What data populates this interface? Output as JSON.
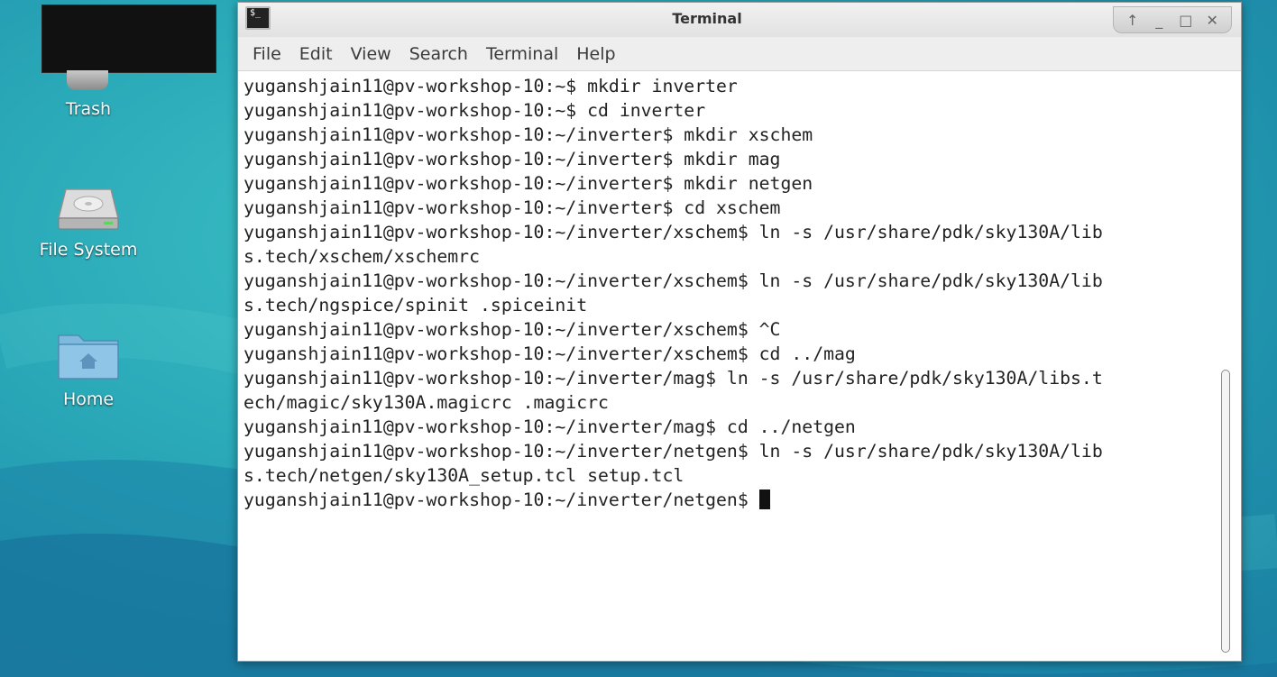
{
  "desktop": {
    "icons": [
      {
        "label": "Trash",
        "icon": "trash-icon"
      },
      {
        "label": "File System",
        "icon": "drive-icon"
      },
      {
        "label": "Home",
        "icon": "home-folder-icon"
      }
    ]
  },
  "window": {
    "title": "Terminal",
    "title_icon_glyph": "$_",
    "controls": {
      "shade": "↑",
      "minimize": "_",
      "maximize": "□",
      "close": "✕"
    },
    "menu": [
      "File",
      "Edit",
      "View",
      "Search",
      "Terminal",
      "Help"
    ]
  },
  "terminal": {
    "lines": [
      "yuganshjain11@pv-workshop-10:~$ mkdir inverter",
      "yuganshjain11@pv-workshop-10:~$ cd inverter",
      "yuganshjain11@pv-workshop-10:~/inverter$ mkdir xschem",
      "yuganshjain11@pv-workshop-10:~/inverter$ mkdir mag",
      "yuganshjain11@pv-workshop-10:~/inverter$ mkdir netgen",
      "yuganshjain11@pv-workshop-10:~/inverter$ cd xschem",
      "yuganshjain11@pv-workshop-10:~/inverter/xschem$ ln -s /usr/share/pdk/sky130A/lib",
      "s.tech/xschem/xschemrc",
      "yuganshjain11@pv-workshop-10:~/inverter/xschem$ ln -s /usr/share/pdk/sky130A/lib",
      "s.tech/ngspice/spinit .spiceinit",
      "yuganshjain11@pv-workshop-10:~/inverter/xschem$ ^C",
      "yuganshjain11@pv-workshop-10:~/inverter/xschem$ cd ../mag",
      "yuganshjain11@pv-workshop-10:~/inverter/mag$ ln -s /usr/share/pdk/sky130A/libs.t",
      "ech/magic/sky130A.magicrc .magicrc",
      "yuganshjain11@pv-workshop-10:~/inverter/mag$ cd ../netgen",
      "yuganshjain11@pv-workshop-10:~/inverter/netgen$ ln -s /usr/share/pdk/sky130A/lib",
      "s.tech/netgen/sky130A_setup.tcl setup.tcl"
    ],
    "prompt": "yuganshjain11@pv-workshop-10:~/inverter/netgen$ "
  }
}
